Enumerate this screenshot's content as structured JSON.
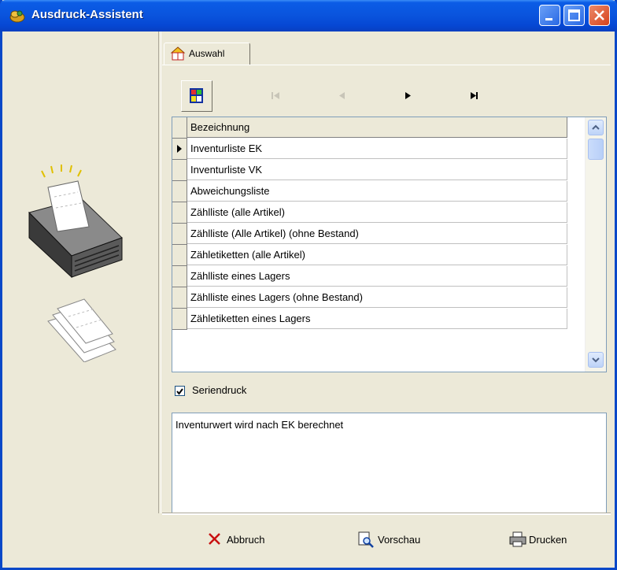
{
  "window": {
    "title": "Ausdruck-Assistent"
  },
  "tab": {
    "label": "Auswahl"
  },
  "grid": {
    "header": "Bezeichnung",
    "rows": [
      "Inventurliste EK",
      "Inventurliste VK",
      "Abweichungsliste",
      "Zählliste (alle Artikel)",
      "Zählliste (Alle Artikel) (ohne Bestand)",
      "Zähletiketten (alle Artikel)",
      "Zählliste eines Lagers",
      "Zählliste eines Lagers (ohne Bestand)",
      "Zähletiketten eines Lagers"
    ],
    "selected_index": 0
  },
  "serial_print": {
    "label": "Seriendruck",
    "checked": true
  },
  "memo": {
    "text": "Inventurwert wird nach EK berechnet"
  },
  "buttons": {
    "cancel": "Abbruch",
    "preview": "Vorschau",
    "print": "Drucken"
  },
  "colors": {
    "titlebar": "#0a55de",
    "face": "#ece9d8",
    "close": "#d6421c"
  }
}
